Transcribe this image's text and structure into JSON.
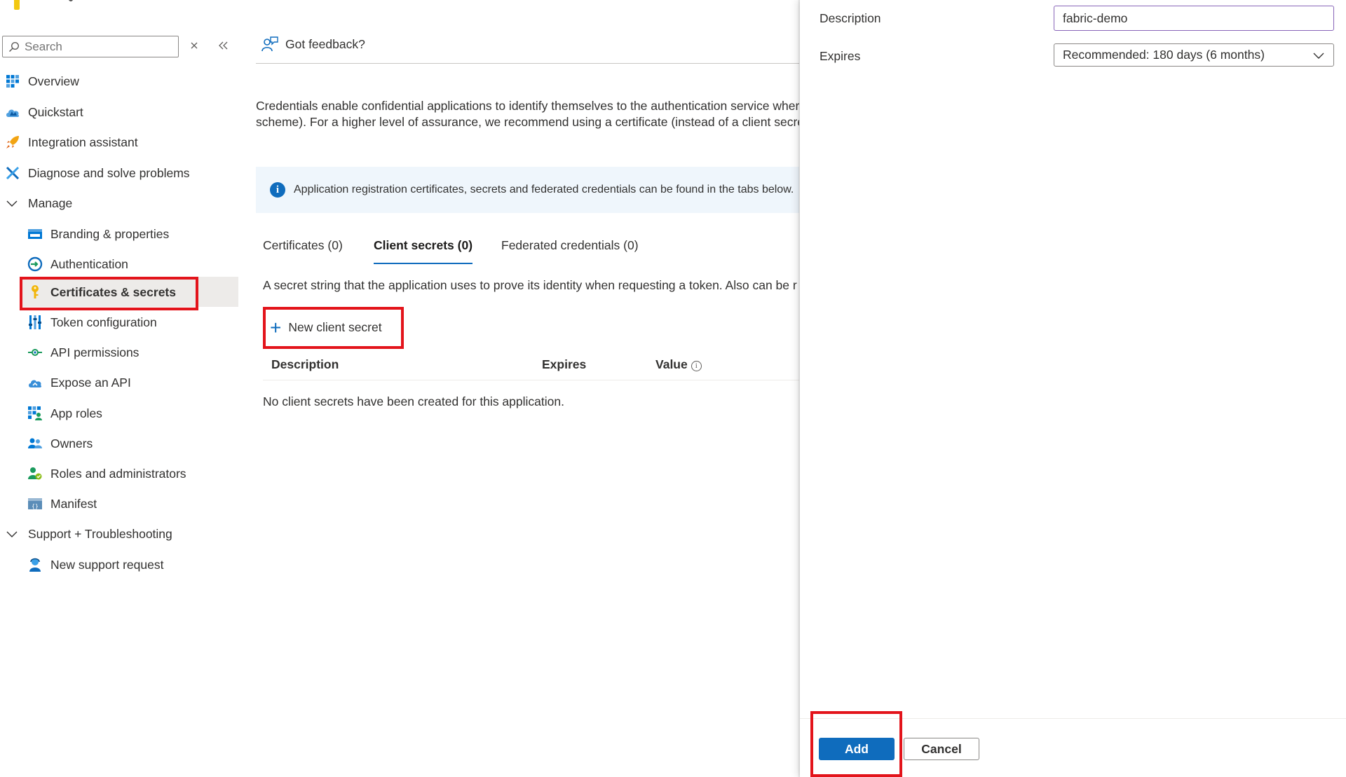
{
  "sidebar": {
    "search": {
      "placeholder": "Search"
    },
    "items": [
      {
        "label": "Overview",
        "icon": "overview-icon"
      },
      {
        "label": "Quickstart",
        "icon": "quickstart-cloud-icon"
      },
      {
        "label": "Integration assistant",
        "icon": "rocket-icon"
      },
      {
        "label": "Diagnose and solve problems",
        "icon": "wrench-icon"
      }
    ],
    "manage": {
      "label": "Manage",
      "items": [
        {
          "label": "Branding & properties",
          "icon": "branding-icon"
        },
        {
          "label": "Authentication",
          "icon": "authentication-icon"
        },
        {
          "label": "Certificates & secrets",
          "icon": "key-icon"
        },
        {
          "label": "Token configuration",
          "icon": "token-config-icon"
        },
        {
          "label": "API permissions",
          "icon": "api-permissions-icon"
        },
        {
          "label": "Expose an API",
          "icon": "cloud-api-icon"
        },
        {
          "label": "App roles",
          "icon": "app-roles-icon"
        },
        {
          "label": "Owners",
          "icon": "owners-icon"
        },
        {
          "label": "Roles and administrators",
          "icon": "roles-admin-icon"
        },
        {
          "label": "Manifest",
          "icon": "manifest-icon"
        }
      ]
    },
    "support": {
      "label": "Support + Troubleshooting",
      "items": [
        {
          "label": "New support request",
          "icon": "support-person-icon"
        }
      ]
    }
  },
  "main": {
    "feedback": "Got feedback?",
    "description_line1": "Credentials enable confidential applications to identify themselves to the authentication service wher",
    "description_line2": "scheme). For a higher level of assurance, we recommend using a certificate (instead of a client secret)",
    "info_banner": "Application registration certificates, secrets and federated credentials can be found in the tabs below.",
    "tabs": [
      {
        "label": "Certificates (0)"
      },
      {
        "label": "Client secrets (0)"
      },
      {
        "label": "Federated credentials (0)"
      }
    ],
    "secret_description": "A secret string that the application uses to prove its identity when requesting a token. Also can be r",
    "new_secret_label": "New client secret",
    "table": {
      "columns": [
        "Description",
        "Expires",
        "Value"
      ],
      "empty_message": "No client secrets have been created for this application."
    }
  },
  "panel": {
    "description_label": "Description",
    "description_value": "fabric-demo",
    "expires_label": "Expires",
    "expires_value": "Recommended: 180 days (6 months)",
    "add_label": "Add",
    "cancel_label": "Cancel"
  },
  "colors": {
    "accent": "#0f6cbd",
    "highlight_box": "#e3141b",
    "selected_bg": "#edebe9",
    "info_bg": "#eff6fc"
  }
}
